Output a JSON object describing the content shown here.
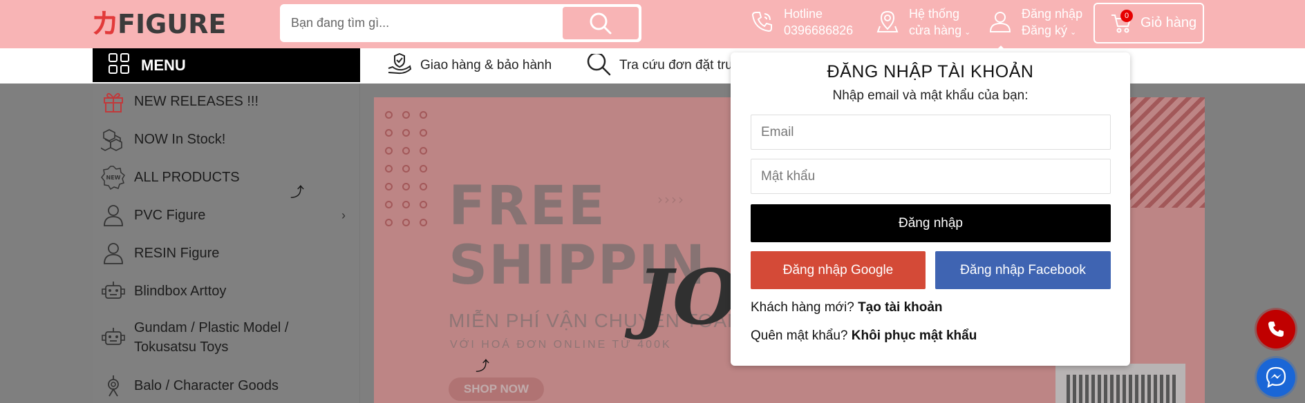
{
  "header": {
    "logo_mark": "カ",
    "logo_text": "FIGURE",
    "search_placeholder": "Bạn đang tìm gì...",
    "hotline_label": "Hotline",
    "hotline_number": "0396686826",
    "stores_line1": "Hệ thống",
    "stores_line2": "cửa hàng",
    "account_line1": "Đăng nhập",
    "account_line2": "Đăng ký",
    "cart_count": "0",
    "cart_label": "Giỏ hàng"
  },
  "nav": {
    "menu_label": "MENU",
    "shipping_label": "Giao hàng & bảo hành",
    "tracking_label": "Tra cứu đơn đặt trước"
  },
  "sidebar": {
    "items": [
      {
        "label": "NEW RELEASES !!!",
        "icon": "gift-icon"
      },
      {
        "label": "NOW In Stock!",
        "icon": "boxes-icon"
      },
      {
        "label": "ALL PRODUCTS",
        "icon": "new-badge-icon"
      },
      {
        "label": "PVC Figure",
        "icon": "person-icon",
        "has_submenu": true
      },
      {
        "label": "RESIN Figure",
        "icon": "person-icon"
      },
      {
        "label": "Blindbox Arttoy",
        "icon": "robot-icon"
      },
      {
        "label": "Gundam / Plastic Model / Tokusatsu Toys",
        "icon": "robot-icon"
      },
      {
        "label": "Balo / Character Goods",
        "icon": "lamp-icon"
      }
    ],
    "submenu_arrow": "›"
  },
  "banner": {
    "headline_line1": "FREE",
    "headline_line2": "SHIPPIN",
    "overlay_text": "JO",
    "subtitle": "MIỄN PHÍ VẬN CHUYỂN TOÀN",
    "note": "VỚI HOÁ ĐƠN ONLINE TỪ 400K",
    "cta": "SHOP NOW",
    "arrows": "››››"
  },
  "login_popup": {
    "title": "ĐĂNG NHẬP TÀI KHOẢN",
    "subtitle": "Nhập email và mật khẩu của bạn:",
    "email_placeholder": "Email",
    "password_placeholder": "Mật khẩu",
    "login_button": "Đăng nhập",
    "google_button": "Đăng nhập Google",
    "facebook_button": "Đăng nhập Facebook",
    "new_customer_prefix": "Khách hàng mới?",
    "new_customer_link": "Tạo tài khoản",
    "forgot_prefix": "Quên mật khẩu?",
    "forgot_link": "Khôi phục mật khẩu"
  },
  "colors": {
    "header_bg": "#f8b4b5",
    "brand_red": "#e23a3a",
    "google_red": "#d44a37",
    "facebook_blue": "#3f64b2",
    "phone_red": "#c00000",
    "messenger_blue": "#1a66d6"
  }
}
